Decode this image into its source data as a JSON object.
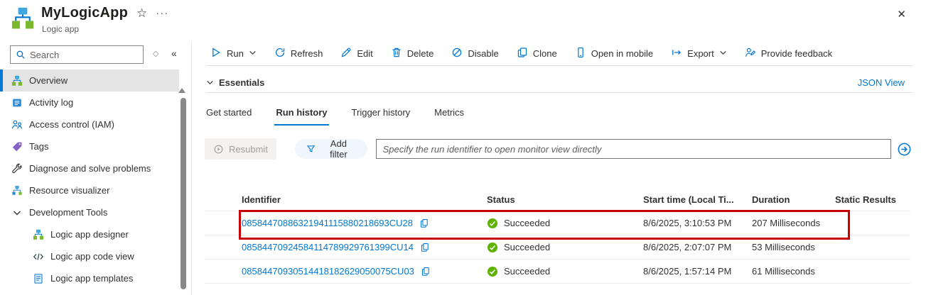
{
  "header": {
    "title": "MyLogicApp",
    "subtitle": "Logic app",
    "star_glyph": "☆",
    "more_glyph": "···",
    "close_glyph": "✕"
  },
  "sidebar": {
    "search_placeholder": "Search",
    "diamond_glyph": "◇",
    "collapse_glyph": "«",
    "items": [
      {
        "label": "Overview",
        "selected": true
      },
      {
        "label": "Activity log"
      },
      {
        "label": "Access control (IAM)"
      },
      {
        "label": "Tags"
      },
      {
        "label": "Diagnose and solve problems"
      },
      {
        "label": "Resource visualizer"
      }
    ],
    "groups": [
      {
        "label": "Development Tools",
        "items": [
          {
            "label": "Logic app designer"
          },
          {
            "label": "Logic app code view"
          },
          {
            "label": "Logic app templates"
          }
        ]
      }
    ]
  },
  "toolbar": {
    "run": "Run",
    "refresh": "Refresh",
    "edit": "Edit",
    "delete": "Delete",
    "disable": "Disable",
    "clone": "Clone",
    "open_in_mobile": "Open in mobile",
    "export": "Export",
    "provide_feedback": "Provide feedback"
  },
  "essentials": {
    "label": "Essentials",
    "json_view_label": "JSON View"
  },
  "tabs": {
    "get_started": "Get started",
    "run_history": "Run history",
    "trigger_history": "Trigger history",
    "metrics": "Metrics",
    "active_tab": "Run history"
  },
  "filter_bar": {
    "resubmit_label": "Resubmit",
    "add_filter_label": "Add filter",
    "input_placeholder": "Specify the run identifier to open monitor view directly"
  },
  "table": {
    "columns": {
      "identifier": "Identifier",
      "status": "Status",
      "start_time": "Start time (Local Ti...",
      "duration": "Duration",
      "static_results": "Static Results"
    },
    "rows": [
      {
        "identifier": "08584470886321941115880218693CU28",
        "status": "Succeeded",
        "start_time": "8/6/2025, 3:10:53 PM",
        "duration": "207 Milliseconds",
        "highlighted": true
      },
      {
        "identifier": "08584470924584114789929761399CU14",
        "status": "Succeeded",
        "start_time": "8/6/2025, 2:07:07 PM",
        "duration": "53 Milliseconds",
        "highlighted": false
      },
      {
        "identifier": "08584470930514418182629050075CU03",
        "status": "Succeeded",
        "start_time": "8/6/2025, 1:57:14 PM",
        "duration": "61 Milliseconds",
        "highlighted": false
      }
    ]
  },
  "colors": {
    "accent": "#0078d4",
    "success_green": "#5db300",
    "highlight_red": "#c70000",
    "disabled_text": "#a19f9d"
  }
}
